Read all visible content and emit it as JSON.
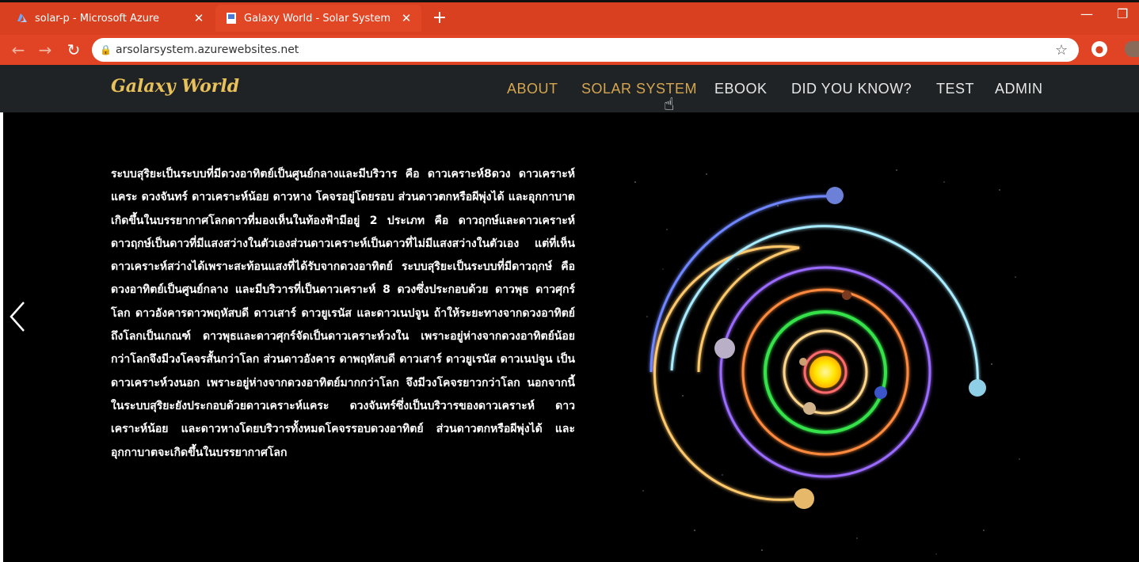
{
  "browser": {
    "tabs": [
      {
        "title": "solar-p - Microsoft Azure",
        "active": false,
        "icon": "azure-icon"
      },
      {
        "title": "Galaxy World - Solar System",
        "active": true,
        "icon": "page-icon"
      }
    ],
    "url": "arsolarsystem.azurewebsites.net",
    "colors": {
      "frame": "#d8401f",
      "toolbar": "#e04425"
    }
  },
  "site": {
    "logo": "Galaxy World",
    "nav": [
      {
        "label": "ABOUT",
        "color": "#d3a64f"
      },
      {
        "label": "SOLAR SYSTEM",
        "color": "#d3a64f"
      },
      {
        "label": "EBOOK",
        "color": "#e6e6e6"
      },
      {
        "label": "DID YOU KNOW?",
        "color": "#e6e6e6"
      },
      {
        "label": "TEST",
        "color": "#e6e6e6"
      },
      {
        "label": "ADMIN",
        "color": "#e6e6e6"
      }
    ]
  },
  "content": {
    "text": "ระบบสุริยะเป็นระบบที่มีดวงอาทิตย์เป็นศูนย์กลางและมีบริวาร คือ ดาวเคราะห์8ดวง ดาวเคราะห์แคระ ดวงจันทร์ ดาวเคราะห์น้อย ดาวหาง โคจรอยู่โดยรอบ ส่วนดาวตกหรือผีพุ่งได้ และอุกกาบาต เกิดขึ้นในบรรยากาศโลกดาวที่มองเห็นในท้องฟ้ามีอยู่ 2 ประเภท คือ ดาวฤกษ์และดาวเคราะห์ ดาวฤกษ์เป็นดาวที่มีแสงสว่างในตัวเองส่วนดาวเคราะห์เป็นดาวที่ไม่มีแสงสว่างในตัวเอง แต่ที่เห็นดาวเคราะห์สว่างได้เพราะสะท้อนแสงที่ได้รับจากดวงอาทิตย์ ระบบสุริยะเป็นระบบที่มีดาวฤกษ์ คือ ดวงอาทิตย์เป็นศูนย์กลาง และมีบริวารที่เป็นดาวเคราะห์ 8 ดวงซึ่งประกอบด้วย ดาวพุธ ดาวศุกร์ โลก ดาวอังคารดาวพฤหัสบดี ดาวเสาร์ ดาวยูเรนัส และดาวเนปจูน ถ้าให้ระยะทางจากดวงอาทิตย์ถึงโลกเป็นเกณฑ์ ดาวพุธและดาวศุกร์จัดเป็นดาวเคราะห์วงใน เพราะอยู่ห่างจากดวงอาทิตย์น้อยกว่าโลกจึงมีวงโคจรสั้นกว่าโลก ส่วนดาวอังคาร ดาพฤหัสบดี ดาวเสาร์ ดาวยูเรนัส ดาวเนปจูน เป็นดาวเคราะห์วงนอก เพราะอยู่ห่างจากดวงอาทิตย์มากกว่าโลก จึงมีวงโคจรยาวกว่าโลก นอกจากนี้ในระบบสุริยะยังประกอบด้วยดาวเคราะห์แคระ ดวงจันทร์ซึ่งเป็นบริวารของดาวเคราะห์ ดาวเคราะห์น้อย และดาวหางโดยบริวารทั้งหมดโคจรรอบดวงอาทิตย์ ส่วนดาวตกหรือผีพุ่งได้ และอุกกาบาตจะเกิดขึ้นในบรรยากาศโลก"
  },
  "solar_system": {
    "sun_color": "#ffe800",
    "orbit_colors": [
      "#ff6b6b",
      "#ffd58a",
      "#36e24a",
      "#ff8a3c",
      "#9b6bff",
      "#ffc86b",
      "#a8ecff",
      "#6f86ff"
    ]
  }
}
